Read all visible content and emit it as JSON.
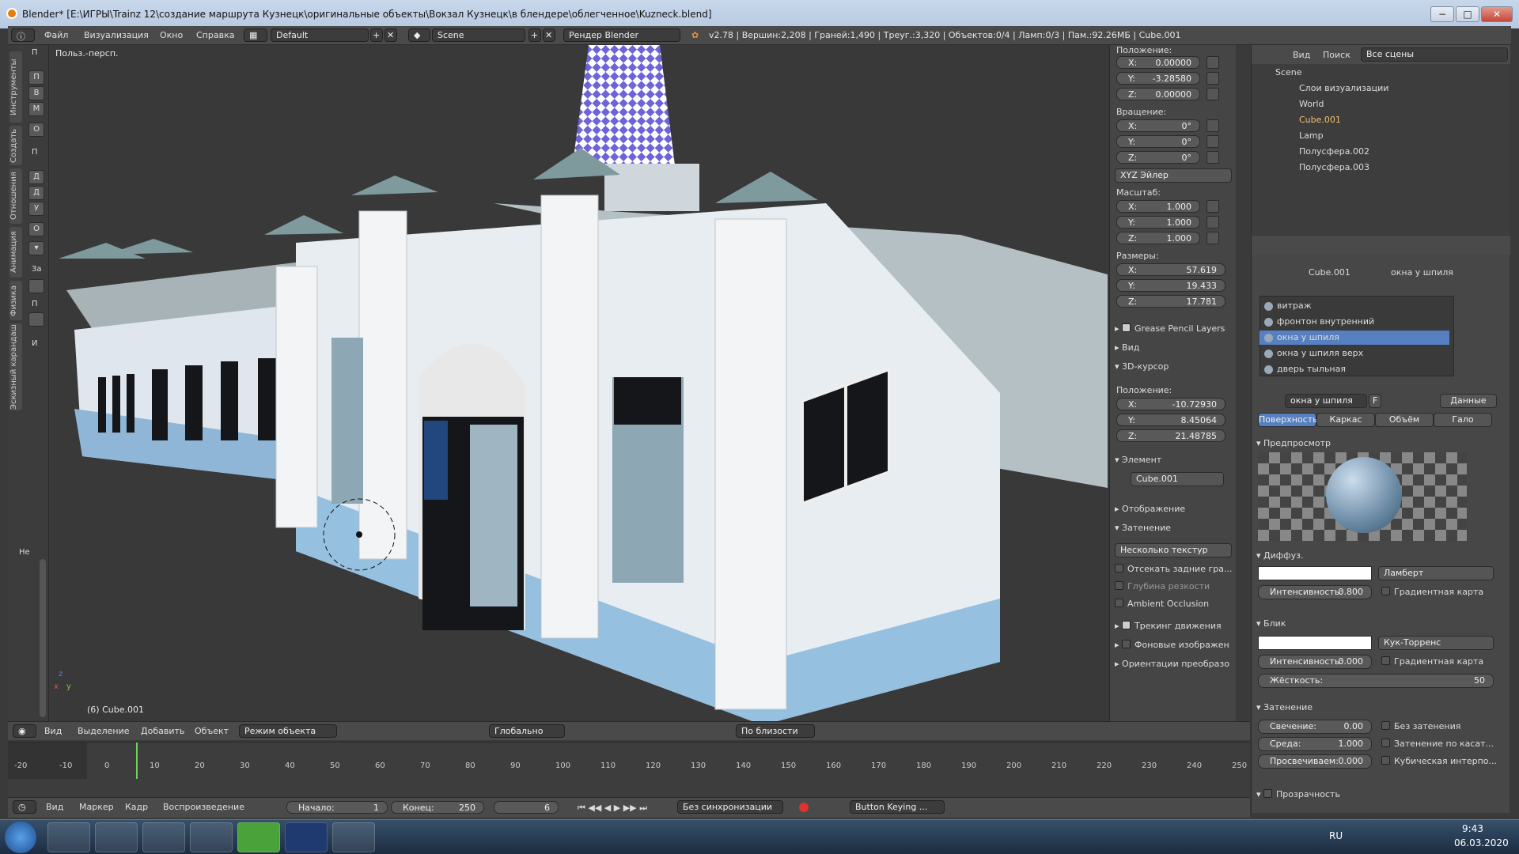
{
  "window": {
    "title": "Blender* [E:\\ИГРЫ\\Trainz 12\\создание маршрута Кузнецк\\оригинальные объекты\\Вокзал Кузнецк\\в блендере\\облегченное\\Kuzneck.blend]",
    "min": "−",
    "max": "□",
    "close": "✕"
  },
  "menubar": {
    "file": "Файл",
    "render": "Визуализация",
    "window": "Окно",
    "help": "Справка",
    "layout": "Default",
    "scene": "Scene",
    "engine": "Рендер Blender",
    "stats": "v2.78 | Вершин:2,208 | Граней:1,490 | Треуг.:3,320 | Объектов:0/4 | Ламп:0/3 | Пам.:92.26МБ | Cube.001"
  },
  "toolshelf": {
    "tabs": [
      "Инструменты",
      "Создать",
      "Отношения",
      "Анимация",
      "Физика",
      "Эскизный карандаш"
    ],
    "headers": [
      "П",
      "П",
      "И"
    ],
    "buttons": [
      "П",
      "В",
      "М",
      "О",
      "Д",
      "Д",
      "У",
      "О",
      "За",
      "П"
    ],
    "bottom": "Не"
  },
  "viewport": {
    "view_label": "Польз.-персп.",
    "object_label": "(6) Cube.001",
    "axis_x": "x",
    "axis_y": "y",
    "axis_z": "z"
  },
  "npanel": {
    "location_label": "Положение:",
    "location": [
      {
        "k": "X:",
        "v": "0.00000"
      },
      {
        "k": "Y:",
        "v": "-3.28580"
      },
      {
        "k": "Z:",
        "v": "0.00000"
      }
    ],
    "rotation_label": "Вращение:",
    "rotation": [
      {
        "k": "X:",
        "v": "0°"
      },
      {
        "k": "Y:",
        "v": "0°"
      },
      {
        "k": "Z:",
        "v": "0°"
      }
    ],
    "rotation_mode": "XYZ Эйлер",
    "scale_label": "Масштаб:",
    "scale": [
      {
        "k": "X:",
        "v": "1.000"
      },
      {
        "k": "Y:",
        "v": "1.000"
      },
      {
        "k": "Z:",
        "v": "1.000"
      }
    ],
    "dims_label": "Размеры:",
    "dims": [
      {
        "k": "X:",
        "v": "57.619"
      },
      {
        "k": "Y:",
        "v": "19.433"
      },
      {
        "k": "Z:",
        "v": "17.781"
      }
    ],
    "grease": "Grease Pencil Layers",
    "view": "Вид",
    "cursor": "3D-курсор",
    "cursor_loc_label": "Положение:",
    "cursor_loc": [
      {
        "k": "X:",
        "v": "-10.72930"
      },
      {
        "k": "Y:",
        "v": "8.45064"
      },
      {
        "k": "Z:",
        "v": "21.48785"
      }
    ],
    "item": "Элемент",
    "item_name": "Cube.001",
    "display": "Отображение",
    "shading": "Затенение",
    "shading_mode": "Несколько текстур",
    "backface": "Отсекать задние гра...",
    "dof": "Глубина резкости",
    "ao": "Ambient Occlusion",
    "motion": "Трекинг движения",
    "bgimg": "Фоновые изображен",
    "orient": "Ориентации преобразо"
  },
  "outliner": {
    "view": "Вид",
    "search": "Поиск",
    "filter": "Все сцены",
    "items": [
      "Scene",
      "Слои визуализации",
      "World",
      "Cube.001",
      "Lamp",
      "Полусфера.002",
      "Полусфера.003"
    ]
  },
  "props": {
    "breadcrumb_obj": "Cube.001",
    "breadcrumb_mat": "окна у шпиля",
    "materials": [
      "витраж",
      "фронтон внутренний",
      "окна у шпиля",
      "окна у шпиля верх",
      "дверь тыльная"
    ],
    "mat_name": "окна у шпиля",
    "mat_f": "F",
    "data": "Данные",
    "tabs": [
      "Поверхность",
      "Каркас",
      "Объём",
      "Гало"
    ],
    "preview": "Предпросмотр",
    "diffuse": "Диффуз.",
    "diffuse_shader": "Ламберт",
    "intensity_label": "Интенсивность:",
    "diffuse_int": "0.800",
    "ramp": "Градиентная карта",
    "specular": "Блик",
    "spec_shader": "Кук-Торренс",
    "spec_int": "0.000",
    "hardness_label": "Жёсткость:",
    "hardness": "50",
    "shading": "Затенение",
    "emit_label": "Свечение:",
    "emit": "0.00",
    "ambient_label": "Среда:",
    "ambient": "1.000",
    "translucency_label": "Просвечиваем:",
    "translucency": "0.000",
    "shadeless": "Без затенения",
    "tangent": "Затенение по касат...",
    "cubic": "Кубическая интерпо...",
    "transparency": "Прозрачность"
  },
  "vpheader": {
    "view": "Вид",
    "select": "Выделение",
    "add": "Добавить",
    "object": "Объект",
    "mode": "Режим объекта",
    "orient": "Глобально",
    "snap": "По близости"
  },
  "timeline": {
    "ticks": [
      "-20",
      "-10",
      "0",
      "10",
      "20",
      "30",
      "40",
      "50",
      "60",
      "70",
      "80",
      "90",
      "100",
      "110",
      "120",
      "130",
      "140",
      "150",
      "160",
      "170",
      "180",
      "190",
      "200",
      "210",
      "220",
      "230",
      "240",
      "250"
    ],
    "view": "Вид",
    "marker": "Маркер",
    "frame": "Кадр",
    "playback": "Воспроизведение",
    "start_label": "Начало:",
    "start": "1",
    "end_label": "Конец:",
    "end": "250",
    "current": "6",
    "sync": "Без синхронизации",
    "keying": "Button Keying ..."
  },
  "taskbar": {
    "lang": "RU",
    "time": "9:43",
    "date": "06.03.2020"
  }
}
